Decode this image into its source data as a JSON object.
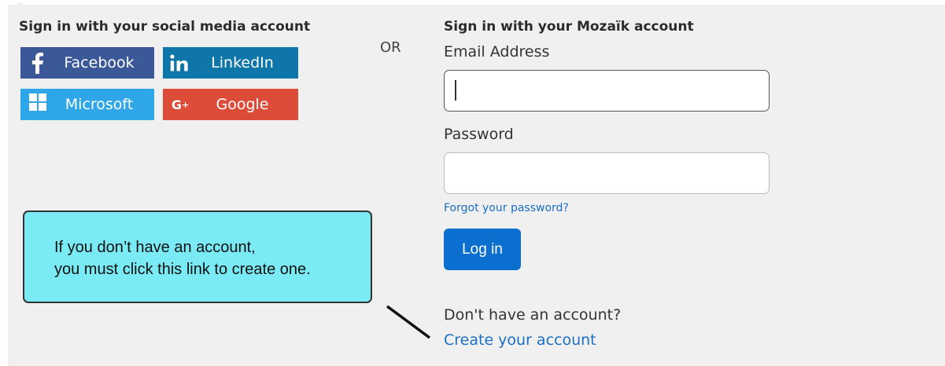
{
  "social": {
    "heading": "Sign in with your social media account",
    "buttons": {
      "facebook": "Facebook",
      "linkedin": "LinkedIn",
      "microsoft": "Microsoft",
      "google": "Google"
    }
  },
  "separator": "OR",
  "account": {
    "heading": "Sign in with your Mozaïk account",
    "email_label": "Email Address",
    "email_value": "",
    "password_label": "Password",
    "password_value": "",
    "forgot_link": "Forgot your password?",
    "login_label": "Log in",
    "no_account_text": "Don't have an account?",
    "create_link": "Create your account"
  },
  "callout": {
    "line1": "If you don’t have an account,",
    "line2": "you must click this link to create one."
  },
  "colors": {
    "facebook": "#3b5998",
    "linkedin": "#0e76a8",
    "microsoft": "#2ea6e8",
    "google": "#dd4b39",
    "primary": "#0a6fcf",
    "link": "#1a6fc4",
    "callout": "#7aebf5"
  },
  "icons": {
    "facebook": "facebook-icon",
    "linkedin": "linkedin-icon",
    "microsoft": "microsoft-icon",
    "google": "google-plus-icon"
  }
}
